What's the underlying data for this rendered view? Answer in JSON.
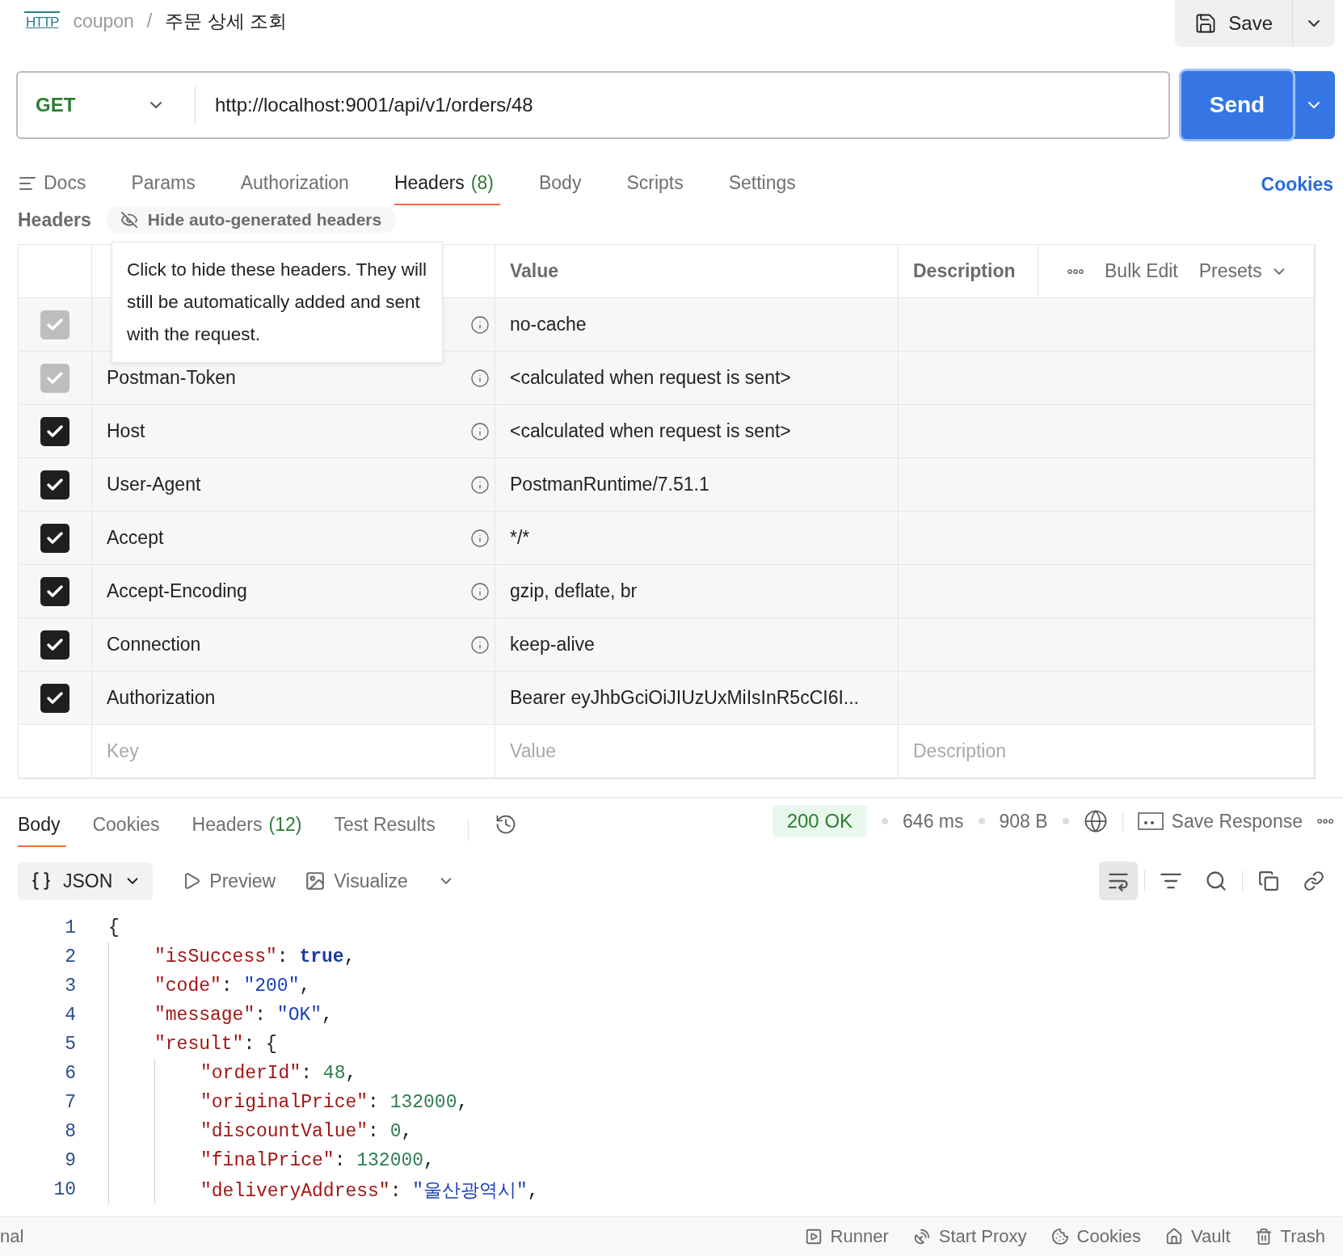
{
  "breadcrumb": {
    "badge": "HTTP",
    "collection": "coupon",
    "separator": "/",
    "request": "주문 상세 조회"
  },
  "save": {
    "label": "Save"
  },
  "request": {
    "method": "GET",
    "url": "http://localhost:9001/api/v1/orders/48",
    "send": "Send"
  },
  "request_tabs": [
    {
      "label": "Docs",
      "selected": false
    },
    {
      "label": "Params",
      "selected": false
    },
    {
      "label": "Authorization",
      "selected": false
    },
    {
      "label": "Headers",
      "count": "(8)",
      "selected": true
    },
    {
      "label": "Body",
      "selected": false
    },
    {
      "label": "Scripts",
      "selected": false
    },
    {
      "label": "Settings",
      "selected": false
    }
  ],
  "cookies_link": "Cookies",
  "headers_section": {
    "title": "Headers",
    "toggle": "Hide auto-generated headers",
    "tooltip": "Click to hide these headers. They will still be automatically added and sent with the request."
  },
  "table": {
    "columns": {
      "value": "Value",
      "description": "Description"
    },
    "actions": {
      "bulk_edit": "Bulk Edit",
      "presets": "Presets"
    },
    "rows": [
      {
        "value": "no-cache",
        "checked": true,
        "disabled": true,
        "info": true
      },
      {
        "key": "Postman-Token",
        "value": "<calculated when request is sent>",
        "checked": true,
        "disabled": true,
        "info": true
      },
      {
        "key": "Host",
        "value": "<calculated when request is sent>",
        "checked": true,
        "disabled": false,
        "info": true
      },
      {
        "key": "User-Agent",
        "value": "PostmanRuntime/7.51.1",
        "checked": true,
        "disabled": false,
        "info": true
      },
      {
        "key": "Accept",
        "value": "*/*",
        "checked": true,
        "disabled": false,
        "info": true
      },
      {
        "key": "Accept-Encoding",
        "value": "gzip, deflate, br",
        "checked": true,
        "disabled": false,
        "info": true
      },
      {
        "key": "Connection",
        "value": "keep-alive",
        "checked": true,
        "disabled": false,
        "info": true
      },
      {
        "key": "Authorization",
        "value": "Bearer eyJhbGciOiJIUzUxMiIsInR5cCI6I...",
        "checked": true,
        "disabled": false,
        "info": false
      }
    ],
    "new_row": {
      "key_placeholder": "Key",
      "value_placeholder": "Value",
      "description_placeholder": "Description"
    }
  },
  "response_tabs": [
    {
      "label": "Body",
      "selected": true
    },
    {
      "label": "Cookies",
      "selected": false
    },
    {
      "label": "Headers",
      "count": "(12)",
      "selected": false
    },
    {
      "label": "Test Results",
      "selected": false
    }
  ],
  "response_meta": {
    "status": "200 OK",
    "time": "646 ms",
    "size": "908 B",
    "save_response": "Save Response"
  },
  "body_toolbar": {
    "format": "JSON",
    "preview": "Preview",
    "visualize": "Visualize",
    "wrap_on": true
  },
  "code": [
    {
      "number": "1",
      "tokens": [
        {
          "kind": "punct",
          "text": "{"
        }
      ],
      "children": [
        {
          "number": "2",
          "tokens": [
            {
              "kind": "key",
              "text": "\"isSuccess\""
            },
            {
              "kind": "punct",
              "text": ": "
            },
            {
              "kind": "bool",
              "text": "true"
            },
            {
              "kind": "punct",
              "text": ","
            }
          ]
        },
        {
          "number": "3",
          "tokens": [
            {
              "kind": "key",
              "text": "\"code\""
            },
            {
              "kind": "punct",
              "text": ": "
            },
            {
              "kind": "string",
              "text": "\"200\""
            },
            {
              "kind": "punct",
              "text": ","
            }
          ]
        },
        {
          "number": "4",
          "tokens": [
            {
              "kind": "key",
              "text": "\"message\""
            },
            {
              "kind": "punct",
              "text": ": "
            },
            {
              "kind": "string",
              "text": "\"OK\""
            },
            {
              "kind": "punct",
              "text": ","
            }
          ]
        },
        {
          "number": "5",
          "tokens": [
            {
              "kind": "key",
              "text": "\"result\""
            },
            {
              "kind": "punct",
              "text": ": {"
            }
          ],
          "children": [
            {
              "number": "6",
              "tokens": [
                {
                  "kind": "key",
                  "text": "\"orderId\""
                },
                {
                  "kind": "punct",
                  "text": ": "
                },
                {
                  "kind": "number",
                  "text": "48"
                },
                {
                  "kind": "punct",
                  "text": ","
                }
              ]
            },
            {
              "number": "7",
              "tokens": [
                {
                  "kind": "key",
                  "text": "\"originalPrice\""
                },
                {
                  "kind": "punct",
                  "text": ": "
                },
                {
                  "kind": "number",
                  "text": "132000"
                },
                {
                  "kind": "punct",
                  "text": ","
                }
              ]
            },
            {
              "number": "8",
              "tokens": [
                {
                  "kind": "key",
                  "text": "\"discountValue\""
                },
                {
                  "kind": "punct",
                  "text": ": "
                },
                {
                  "kind": "number",
                  "text": "0"
                },
                {
                  "kind": "punct",
                  "text": ","
                }
              ]
            },
            {
              "number": "9",
              "tokens": [
                {
                  "kind": "key",
                  "text": "\"finalPrice\""
                },
                {
                  "kind": "punct",
                  "text": ": "
                },
                {
                  "kind": "number",
                  "text": "132000"
                },
                {
                  "kind": "punct",
                  "text": ","
                }
              ]
            },
            {
              "number": "10",
              "tokens": [
                {
                  "kind": "key",
                  "text": "\"deliveryAddress\""
                },
                {
                  "kind": "punct",
                  "text": ": "
                },
                {
                  "kind": "string",
                  "text": "\"울산광역시\""
                },
                {
                  "kind": "punct",
                  "text": ","
                }
              ]
            }
          ]
        }
      ]
    }
  ],
  "status_bar": {
    "left": "nal",
    "items": [
      {
        "label": "Runner"
      },
      {
        "label": "Start Proxy"
      },
      {
        "label": "Cookies"
      },
      {
        "label": "Vault"
      },
      {
        "label": "Trash"
      }
    ]
  }
}
